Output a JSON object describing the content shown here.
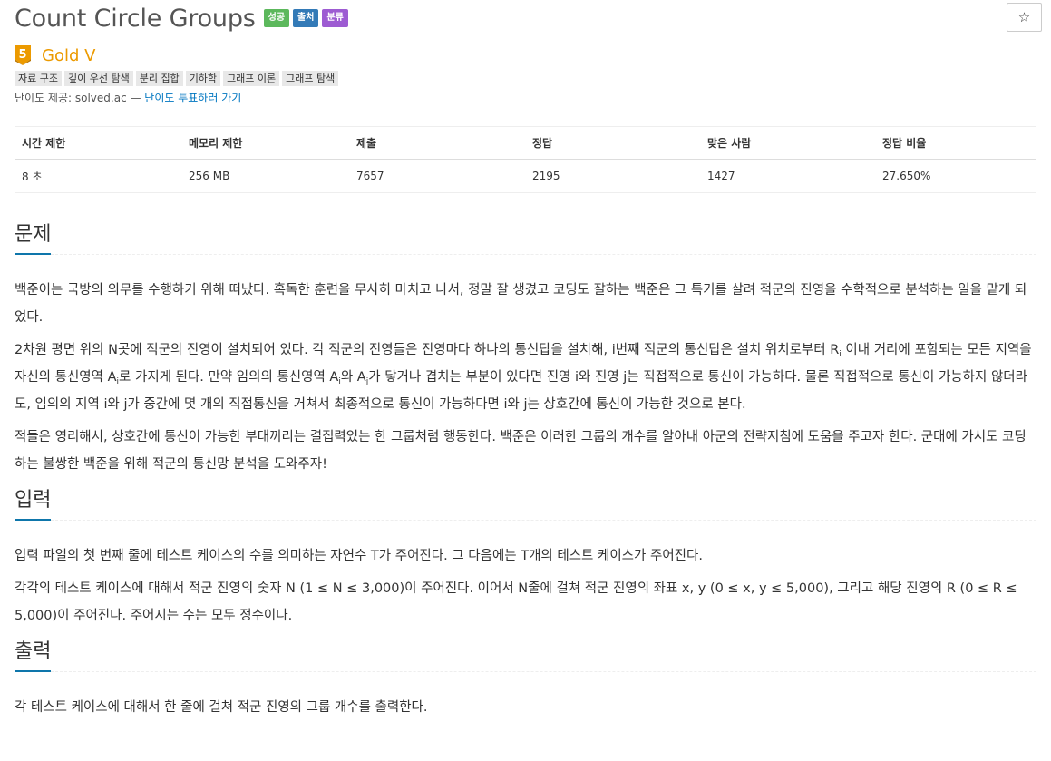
{
  "problem": {
    "title": "Count Circle Groups",
    "labels": [
      {
        "text": "성공",
        "color": "#5cb85c"
      },
      {
        "text": "출처",
        "color": "#337ab7"
      },
      {
        "text": "분류",
        "color": "#9d5bd2"
      }
    ],
    "star_glyph": "☆",
    "tier": {
      "number": "5",
      "name": "Gold V",
      "color": "#ec9a00"
    },
    "tags": [
      "자료 구조",
      "깊이 우선 탐색",
      "분리 집합",
      "기하학",
      "그래프 이론",
      "그래프 탐색"
    ],
    "provider_text": "난이도 제공: solved.ac — ",
    "provider_link": "난이도 투표하러 가기"
  },
  "info_table": {
    "headers": [
      "시간 제한",
      "메모리 제한",
      "제출",
      "정답",
      "맞은 사람",
      "정답 비율"
    ],
    "row": [
      "8 초",
      "256 MB",
      "7657",
      "2195",
      "1427",
      "27.650%"
    ]
  },
  "sections": {
    "problem": {
      "heading": "문제",
      "p1": "백준이는 국방의 의무를 수행하기 위해 떠났다. 혹독한 훈련을 무사히 마치고 나서, 정말 잘 생겼고 코딩도 잘하는 백준은 그 특기를 살려 적군의 진영을 수학적으로 분석하는 일을 맡게 되었다.",
      "p2": {
        "a": "2차원 평면 위의 N곳에 적군의 진영이 설치되어 있다. 각 적군의 진영들은 진영마다 하나의 통신탑을 설치해, i번째 적군의 통신탑은 설치 위치로부터 R",
        "a_sub": "i",
        "b": " 이내 거리에 포함되는 모든 지역을 자신의 통신영역 A",
        "b_sub": "i",
        "c": "로 가지게 된다. 만약 임의의 통신영역 A",
        "c_sub": "i",
        "d": "와 A",
        "d_sub": "j",
        "e": "가 닿거나 겹치는 부분이 있다면 진영 i와 진영 j는 직접적으로 통신이 가능하다. 물론 직접적으로 통신이 가능하지 않더라도, 임의의 지역 i와 j가 중간에 몇 개의 직접통신을 거쳐서 최종적으로 통신이 가능하다면 i와 j는 상호간에 통신이 가능한 것으로 본다."
      },
      "p3": "적들은 영리해서, 상호간에 통신이 가능한 부대끼리는 결집력있는 한 그룹처럼 행동한다. 백준은 이러한 그룹의 개수를 알아내 아군의 전략지침에 도움을 주고자 한다. 군대에 가서도 코딩하는 불쌍한 백준을 위해 적군의 통신망 분석을 도와주자!"
    },
    "input": {
      "heading": "입력",
      "p1": "입력 파일의 첫 번째 줄에 테스트 케이스의 수를 의미하는 자연수 T가 주어진다. 그 다음에는 T개의 테스트 케이스가 주어진다.",
      "p2": "각각의 테스트 케이스에 대해서 적군 진영의 숫자 N (1 ≤ N ≤ 3,000)이 주어진다. 이어서 N줄에 걸쳐 적군 진영의 좌표 x, y (0 ≤ x, y ≤ 5,000), 그리고 해당 진영의 R (0 ≤ R ≤ 5,000)이 주어진다. 주어지는 수는 모두 정수이다."
    },
    "output": {
      "heading": "출력",
      "p1": "각 테스트 케이스에 대해서 한 줄에 걸쳐 적군 진영의 그룹 개수를 출력한다."
    }
  }
}
